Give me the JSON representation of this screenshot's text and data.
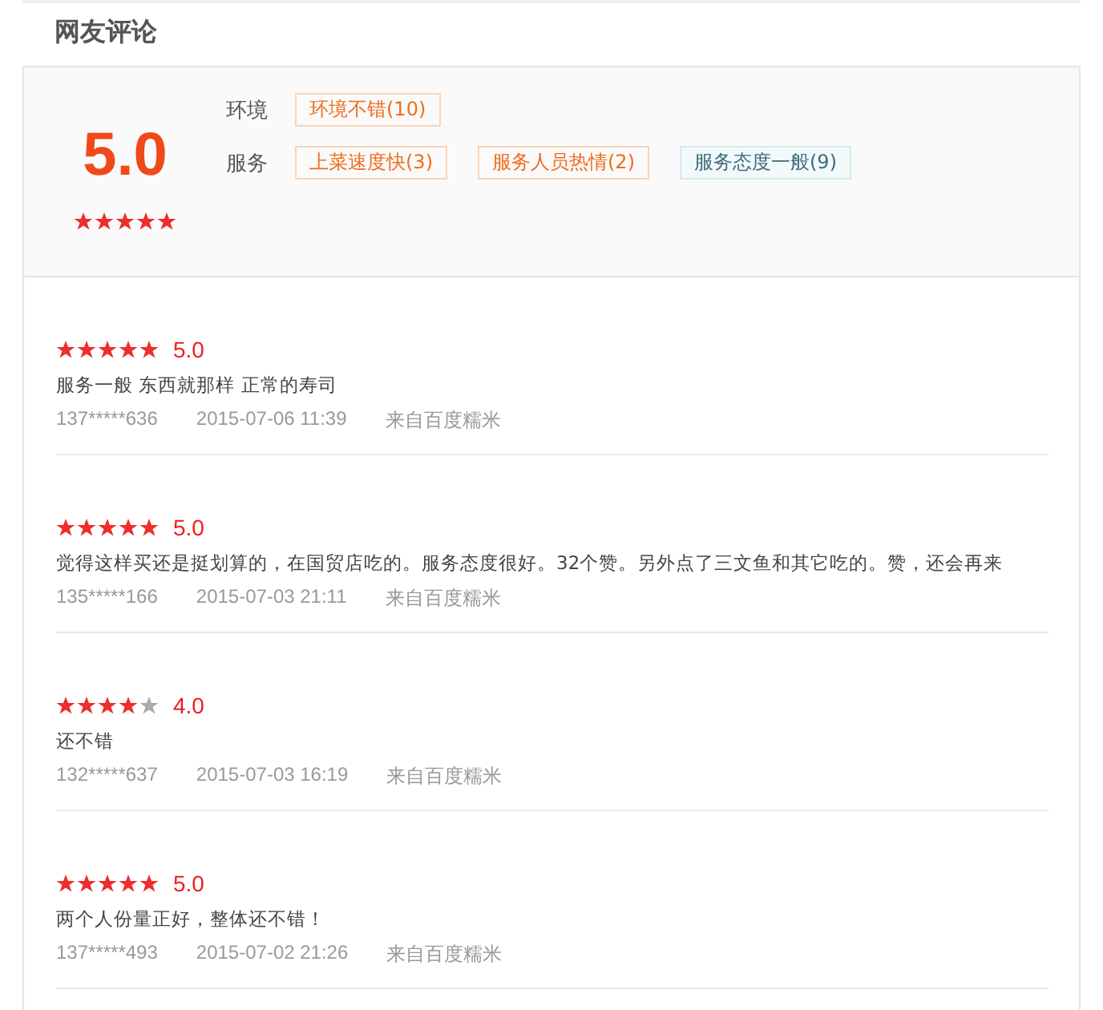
{
  "title": "网友评论",
  "summary": {
    "score": "5.0",
    "stars": 5,
    "groups": [
      {
        "label": "环境",
        "tags": [
          {
            "text": "环境不错(10)",
            "kind": "positive"
          }
        ]
      },
      {
        "label": "服务",
        "tags": [
          {
            "text": "上菜速度快(3)",
            "kind": "positive"
          },
          {
            "text": "服务人员热情(2)",
            "kind": "positive"
          },
          {
            "text": "服务态度一般(9)",
            "kind": "neutral"
          }
        ]
      }
    ]
  },
  "reviews": [
    {
      "stars": 5,
      "score": "5.0",
      "text": "服务一般 东西就那样 正常的寿司",
      "user": "137*****636",
      "time": "2015-07-06 11:39",
      "source": "来自百度糯米"
    },
    {
      "stars": 5,
      "score": "5.0",
      "text": "觉得这样买还是挺划算的，在国贸店吃的。服务态度很好。32个赞。另外点了三文鱼和其它吃的。赞，还会再来",
      "user": "135*****166",
      "time": "2015-07-03 21:11",
      "source": "来自百度糯米"
    },
    {
      "stars": 4,
      "score": "4.0",
      "text": "还不错",
      "user": "132*****637",
      "time": "2015-07-03 16:19",
      "source": "来自百度糯米"
    },
    {
      "stars": 5,
      "score": "5.0",
      "text": "两个人份量正好，整体还不错！",
      "user": "137*****493",
      "time": "2015-07-02 21:26",
      "source": "来自百度糯米"
    }
  ]
}
